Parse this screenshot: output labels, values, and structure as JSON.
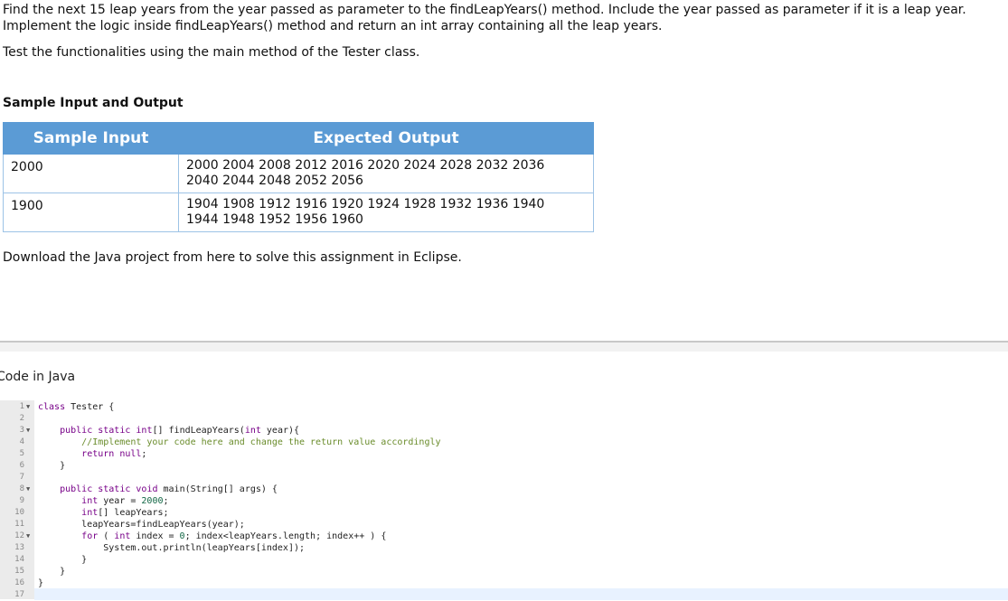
{
  "description": {
    "line1": "Find the next 15 leap years from the year passed as parameter to the findLeapYears() method. Include the year passed as parameter if it is a leap year.",
    "line2": "Implement the logic inside findLeapYears() method and return an int array containing all the leap years.",
    "test_note": "Test the functionalities using the main method of the Tester class."
  },
  "sample": {
    "title": "Sample Input and Output",
    "headers": [
      "Sample Input",
      "Expected Output"
    ],
    "rows": [
      {
        "input": "2000",
        "output": [
          "2000 2004 2008 2012 2016 2020 2024 2028 2032 2036",
          "2040 2044 2048 2052 2056"
        ]
      },
      {
        "input": "1900",
        "output": [
          "1904 1908 1912 1916 1920 1924 1928 1932 1936 1940",
          "1944 1948 1952 1956 1960"
        ]
      }
    ]
  },
  "download_text": "Download the Java project from here to solve this assignment in Eclipse.",
  "code_label": "Code in Java",
  "colors": {
    "header_bg": "#5b9bd5",
    "table_border": "#9dc3e6",
    "gutter_bg": "#ebebeb"
  },
  "code": {
    "line_numbers": [
      "1",
      "2",
      "3",
      "4",
      "5",
      "6",
      "7",
      "8",
      "9",
      "10",
      "11",
      "12",
      "13",
      "14",
      "15",
      "16",
      "17"
    ],
    "lines": [
      "class Tester {",
      "",
      "    public static int[] findLeapYears(int year){",
      "        //Implement your code here and change the return value accordingly",
      "        return null;",
      "    }",
      "",
      "    public static void main(String[] args) {",
      "        int year = 2000;",
      "        int[] leapYears;",
      "        leapYears=findLeapYears(year);",
      "        for ( int index = 0; index<leapYears.length; index++ ) {",
      "            System.out.println(leapYears[index]);",
      "        }",
      "    }",
      "}",
      ""
    ]
  }
}
